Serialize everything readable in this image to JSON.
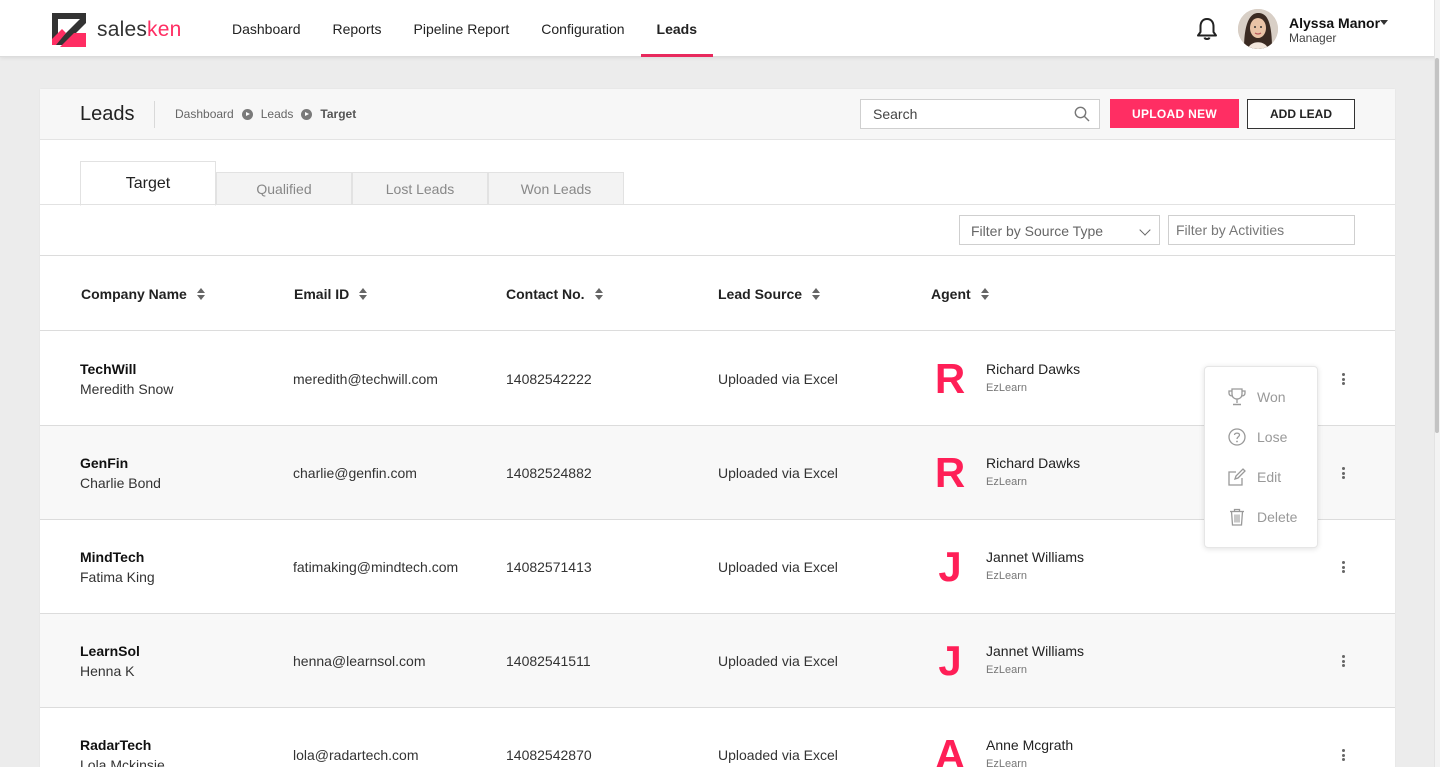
{
  "app": {
    "logo_text_prefix": "sales",
    "logo_text_suffix": "ken",
    "brand_color": "#ff2e63"
  },
  "nav": {
    "items": [
      {
        "label": "Dashboard"
      },
      {
        "label": "Reports"
      },
      {
        "label": "Pipeline Report"
      },
      {
        "label": "Configuration"
      },
      {
        "label": "Leads",
        "active": true
      }
    ]
  },
  "user": {
    "name": "Alyssa Manor",
    "role": "Manager"
  },
  "page": {
    "title": "Leads",
    "breadcrumb": [
      "Dashboard",
      "Leads",
      "Target"
    ],
    "search_placeholder": "Search",
    "upload_label": "UPLOAD NEW",
    "add_label": "ADD LEAD"
  },
  "tabs": [
    {
      "label": "Target",
      "active": true
    },
    {
      "label": "Qualified"
    },
    {
      "label": "Lost Leads"
    },
    {
      "label": "Won Leads"
    }
  ],
  "filters": {
    "source_label": "Filter by Source Type",
    "activities_placeholder": "Filter by Activities"
  },
  "table": {
    "columns": [
      "Company Name",
      "Email ID",
      "Contact No.",
      "Lead Source",
      "Agent"
    ],
    "rows": [
      {
        "company": "TechWill",
        "contact": "Meredith Snow",
        "email": "meredith@techwill.com",
        "phone": "14082542222",
        "source": "Uploaded via Excel",
        "agent_letter": "R",
        "agent": "Richard Dawks",
        "org": "EzLearn"
      },
      {
        "company": "GenFin",
        "contact": "Charlie Bond",
        "email": "charlie@genfin.com",
        "phone": "14082524882",
        "source": "Uploaded via Excel",
        "agent_letter": "R",
        "agent": "Richard Dawks",
        "org": "EzLearn"
      },
      {
        "company": "MindTech",
        "contact": "Fatima King",
        "email": "fatimaking@mindtech.com",
        "phone": "14082571413",
        "source": "Uploaded via Excel",
        "agent_letter": "J",
        "agent": "Jannet Williams",
        "org": "EzLearn"
      },
      {
        "company": "LearnSol",
        "contact": "Henna K",
        "email": "henna@learnsol.com",
        "phone": "14082541511",
        "source": "Uploaded via Excel",
        "agent_letter": "J",
        "agent": "Jannet Williams",
        "org": "EzLearn"
      },
      {
        "company": "RadarTech",
        "contact": "Lola Mckinsie",
        "email": "lola@radartech.com",
        "phone": "14082542870",
        "source": "Uploaded via Excel",
        "agent_letter": "A",
        "agent": "Anne Mcgrath",
        "org": "EzLearn"
      }
    ]
  },
  "row_menu": {
    "items": [
      {
        "label": "Won",
        "icon": "trophy-icon"
      },
      {
        "label": "Lose",
        "icon": "question-circle-icon"
      },
      {
        "label": "Edit",
        "icon": "edit-icon"
      },
      {
        "label": "Delete",
        "icon": "trash-icon"
      }
    ]
  }
}
